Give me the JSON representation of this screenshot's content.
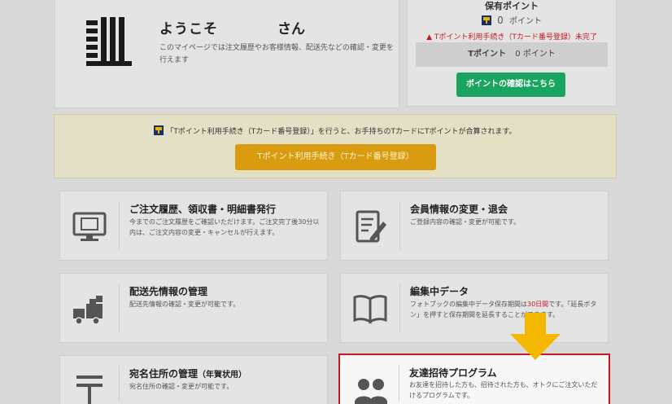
{
  "welcome": {
    "title": "ようこそ",
    "suffix": "さん",
    "description": "このマイページでは注文履歴やお客様情報、配送先などの確認・変更を行えます"
  },
  "points": {
    "title": "保有ポイント",
    "value": "0",
    "unit": "ポイント",
    "warning": "Tポイント利用手続き（Tカード番号登録）未完了",
    "tpoint_label": "Tポイント",
    "tpoint_value": "0 ポイント",
    "check_button": "ポイントの確認はこちら"
  },
  "banner": {
    "text": "「Tポイント利用手続き（Tカード番号登録）」を行うと、お手持ちのTカードにTポイントが合算されます。",
    "button": "Tポイント利用手続き（Tカード番号登録）"
  },
  "cards": {
    "orders": {
      "title": "ご注文履歴、領収書・明細書発行",
      "desc": "今までのご注文履歴をご確認いただけます。ご注文完了後30分以内は、ご注文内容の変更・キャンセルが行えます。"
    },
    "member": {
      "title": "会員情報の変更・退会",
      "desc": "ご登録内容の確認・変更が可能です。"
    },
    "shipping": {
      "title": "配送先情報の管理",
      "desc": "配送先情報の確認・変更が可能です。"
    },
    "editing": {
      "title": "編集中データ",
      "desc_a": "フォトブックの編集中データ保存期間は",
      "desc_red": "30日間",
      "desc_b": "です。「延長ボタン」を押すと保存期間を延長することができます。"
    },
    "address": {
      "title": "宛名住所の管理",
      "title_suffix": "（年賀状用）",
      "desc": "宛名住所の確認・変更が可能です。"
    },
    "friend": {
      "title": "友達招待プログラム",
      "desc": "お友達を招待した方も、招待された方も、オトクにご注文いただけるプログラムです。"
    }
  },
  "colors": {
    "accent_green": "#19a55f",
    "accent_orange": "#d99c10",
    "highlight_red": "#c8181e",
    "arrow_yellow": "#f5b800"
  }
}
